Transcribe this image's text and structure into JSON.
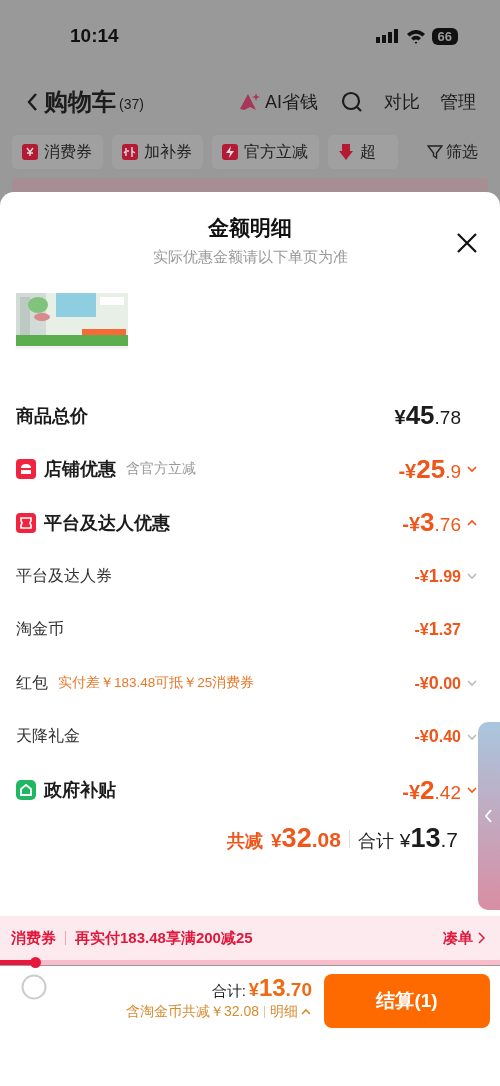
{
  "status_bar": {
    "time": "10:14",
    "battery": "66"
  },
  "nav": {
    "title": "购物车",
    "count": "(37)",
    "ai_label": "AI省钱",
    "actions": [
      "对比",
      "管理"
    ]
  },
  "filter_chips": [
    {
      "label": "消费券",
      "kind": "coupon"
    },
    {
      "label": "加补券",
      "kind": "subsidy"
    },
    {
      "label": "官方立减",
      "kind": "flash"
    },
    {
      "label": "超",
      "kind": "down"
    }
  ],
  "filter": "筛选",
  "sheet": {
    "title": "金额明细",
    "subtitle": "实际优惠金额请以下单页为准",
    "rows": [
      {
        "kind": "total",
        "label": "商品总价",
        "amount": "¥45.78"
      },
      {
        "kind": "shop",
        "label": "店铺优惠",
        "note": "含官方立减",
        "amount": "-¥25.9",
        "expanded": false
      },
      {
        "kind": "platform",
        "label": "平台及达人优惠",
        "amount": "-¥3.76",
        "expanded": true
      },
      {
        "kind": "sub",
        "label": "平台及达人券",
        "amount": "-¥1.99",
        "expanded": false
      },
      {
        "kind": "sub",
        "label": "淘金币",
        "amount": "-¥1.37"
      },
      {
        "kind": "sub",
        "label": "红包",
        "note": "实付差￥183.48可抵￥25消费券",
        "amount": "-¥0.00",
        "expanded": false
      },
      {
        "kind": "sub",
        "label": "天降礼金",
        "amount": "-¥0.40",
        "expanded": false
      },
      {
        "kind": "government",
        "label": "政府补贴",
        "amount": "-¥2.42",
        "expanded": false
      }
    ],
    "totals": {
      "saved_label": "共减",
      "saved": "¥32.08",
      "total_label": "合计",
      "total": "¥13.7"
    }
  },
  "coupon_bar": {
    "tag": "消费券",
    "message": "再实付183.48享满200减25",
    "link": "凑单",
    "level": 0.07
  },
  "checkout": {
    "selected": false,
    "total_label": "合计:",
    "total": "¥13.70",
    "note": "含淘金币共减￥32.08",
    "detail": "明细",
    "button": "结算(1)"
  }
}
